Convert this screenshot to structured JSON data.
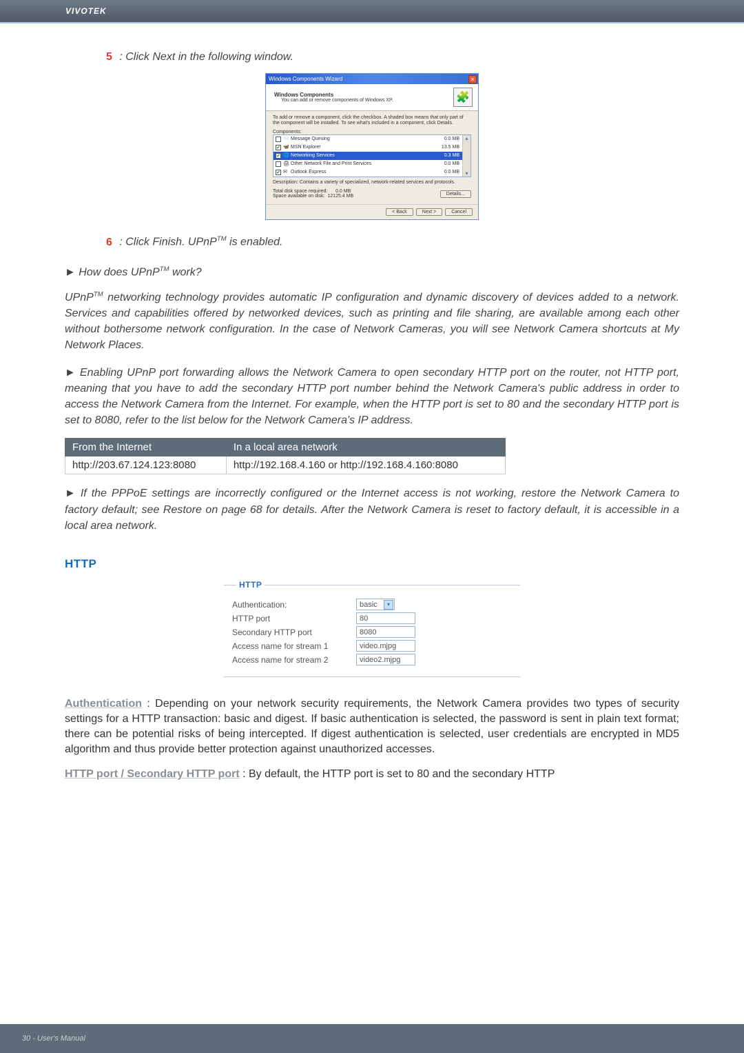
{
  "header": {
    "brand": "VIVOTEK"
  },
  "step5": {
    "num": "5",
    "text": ": Click Next in the following window."
  },
  "wizard": {
    "title": "Windows Components Wizard",
    "heading": "Windows Components",
    "subheading": "You can add or remove components of Windows XP.",
    "hint": "To add or remove a component, click the checkbox. A shaded box means that only part of the component will be installed. To see what's included in a component, click Details.",
    "components_label": "Components:",
    "rows": [
      {
        "checked": false,
        "name": "Message Queuing",
        "size": "0.0 MB"
      },
      {
        "checked": true,
        "name": "MSN Explorer",
        "size": "13.5 MB"
      },
      {
        "checked": true,
        "name": "Networking Services",
        "size": "0.3 MB",
        "selected": true
      },
      {
        "checked": false,
        "name": "Other Network File and Print Services",
        "size": "0.0 MB"
      },
      {
        "checked": true,
        "name": "Outlook Express",
        "size": "0.0 MB"
      }
    ],
    "description": "Description:  Contains a variety of specialized, network-related services and protocols.",
    "total_req_label": "Total disk space required:",
    "total_req": "0.0 MB",
    "space_avail_label": "Space available on disk:",
    "space_avail": "12125.4 MB",
    "details_btn": "Details...",
    "back_btn": "< Back",
    "next_btn": "Next >",
    "cancel_btn": "Cancel"
  },
  "step6": {
    "num": "6",
    "text_a": ": Click Finish. UPnP",
    "text_b": " is enabled."
  },
  "howq": {
    "a": "► How does UPnP",
    "b": " work?"
  },
  "para_upnp": "UPnP",
  "para_upnp_rest": " networking technology provides automatic IP configuration and dynamic discovery of devices added to a network. Services and capabilities offered by networked devices, such as printing and file sharing, are available among each other without bothersome network configuration. In the case of Network Cameras, you will see Network Camera shortcuts at My Network Places.",
  "para_portfwd": "► Enabling UPnP port forwarding allows the Network Camera to open secondary HTTP port on the router, not HTTP port, meaning that you have to add the secondary HTTP port number behind the Network Camera's public address in order to access the Network Camera from the Internet. For example, when the HTTP port is set to 80 and the secondary HTTP port is set to 8080, refer to the list below for the Network Camera's IP address.",
  "table": {
    "h1": "From the Internet",
    "h2": "In a local area network",
    "c1": "http://203.67.124.123:8080",
    "c2": "http://192.168.4.160 or http://192.168.4.160:8080"
  },
  "para_pppoe": "► If the PPPoE settings are incorrectly configured or the Internet access is not working, restore the Network Camera to factory default; see Restore on page 68 for details. After the Network Camera is reset to factory default, it is accessible in a local area network.",
  "section_http": "HTTP",
  "http_panel": {
    "legend": "HTTP",
    "auth_label": "Authentication:",
    "auth_value": "basic",
    "port_label": "HTTP port",
    "port_value": "80",
    "sec_label": "Secondary HTTP port",
    "sec_value": "8080",
    "s1_label": "Access name for stream 1",
    "s1_value": "video.mjpg",
    "s2_label": "Access name for stream 2",
    "s2_value": "video2.mjpg"
  },
  "auth_para_label": "Authentication",
  "auth_para": " : Depending on your network security requirements, the Network Camera provides two types of security settings for a HTTP transaction: basic and digest. If basic authentication is selected, the password is sent in plain text format; there can be potential risks of being intercepted. If digest authentication is selected, user credentials are encrypted in MD5 algorithm and thus provide better protection against unauthorized accesses.",
  "port_para_label": "HTTP port / Secondary HTTP port",
  "port_para": " : By default, the HTTP port is set to 80 and the secondary HTTP",
  "footer": "30 - User's Manual"
}
